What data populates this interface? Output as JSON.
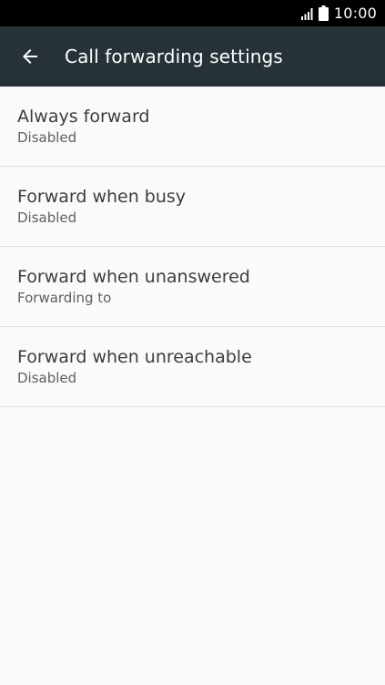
{
  "status_bar": {
    "time": "10:00",
    "icons": [
      "signal-icon",
      "battery-icon"
    ]
  },
  "app_bar": {
    "back_icon": "arrow-left-icon",
    "title": "Call forwarding settings",
    "background": "#263238"
  },
  "settings": [
    {
      "title": "Always forward",
      "summary": "Disabled"
    },
    {
      "title": "Forward when busy",
      "summary": "Disabled"
    },
    {
      "title": "Forward when unanswered",
      "summary": "Forwarding to"
    },
    {
      "title": "Forward when unreachable",
      "summary": "Disabled"
    }
  ]
}
